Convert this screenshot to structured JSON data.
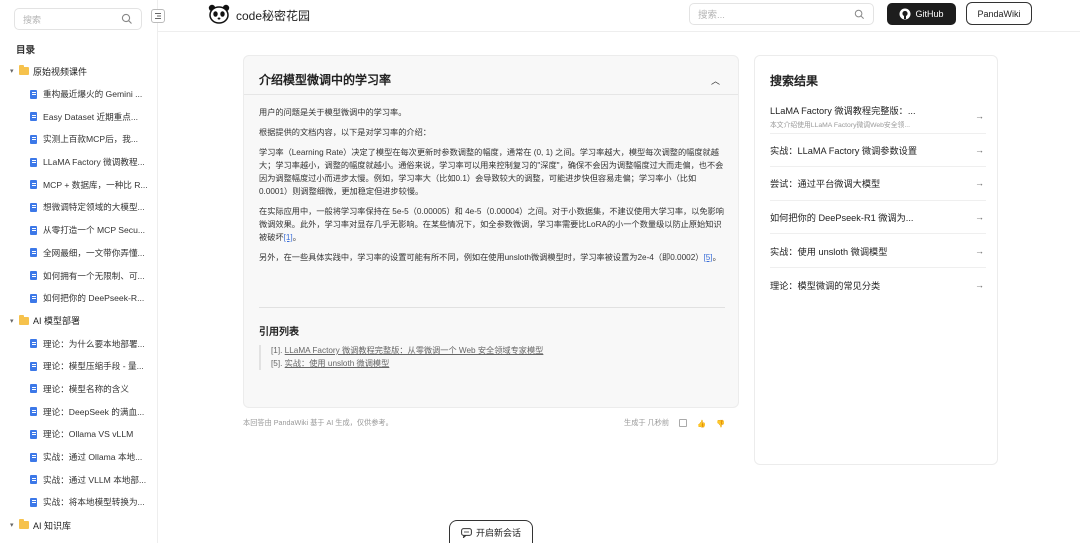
{
  "sidebar": {
    "search_placeholder": "搜索",
    "toc_title": "目录",
    "folders": [
      {
        "label": "原始视频课件",
        "docs": [
          "重构最近爆火的 Gemini ...",
          "Easy Dataset 近期重点...",
          "实测上百款MCP后，我...",
          "LLaMA Factory 微调教程...",
          "MCP + 数据库，一种比 R...",
          "想微调特定领域的大模型...",
          "从零打造一个 MCP Secu...",
          "全网最细，一文带你弄懂...",
          "如何拥有一个无限制、可...",
          "如何把你的 DeePseek-R..."
        ]
      },
      {
        "label": "AI 模型部署",
        "docs": [
          "理论：为什么要本地部署...",
          "理论：模型压缩手段 - 量...",
          "理论：模型名称的含义",
          "理论：DeepSeek 的满血...",
          "理论：Ollama VS vLLM",
          "实战：通过 Ollama 本地...",
          "实战：通过 VLLM 本地部...",
          "实战：将本地模型转换为..."
        ]
      },
      {
        "label": "AI 知识库",
        "docs": []
      }
    ]
  },
  "header": {
    "brand": "code秘密花园",
    "search_placeholder": "搜索...",
    "github_label": "GitHub",
    "pandawiki_label": "PandaWiki"
  },
  "answer": {
    "title": "介绍模型微调中的学习率",
    "p1": "用户的问题是关于模型微调中的学习率。",
    "p2": "根据提供的文档内容，以下是对学习率的介绍：",
    "p3": "学习率（Learning Rate）决定了模型在每次更新时参数调整的幅度，通常在 (0, 1) 之间。学习率越大，模型每次调整的幅度就越大；学习率越小，调整的幅度就越小。通俗来说，学习率可以用来控制复习的\"深度\"，确保不会因为调整幅度过大而走偏，也不会因为调整幅度过小而进步太慢。例如，学习率大（比如0.1）会导致较大的调整，可能进步快但容易走偏；学习率小（比如0.0001）则调整细微，更加稳定但进步较慢。",
    "p4": "在实际应用中，一般将学习率保持在 5e-5（0.00005）和 4e-5（0.00004）之间。对于小数据集，不建议使用大学习率，以免影响微调效果。此外，学习率对显存几乎无影响。在某些情况下，如全参数微调，学习率需要比LoRA的小一个数量级以防止原始知识被破坏",
    "p4_ref": "[1]",
    "p5": "另外，在一些具体实践中，学习率的设置可能有所不同，例如在使用unsloth微调模型时，学习率被设置为2e-4（即0.0002）",
    "p5_ref": "[5]",
    "refs_title": "引用列表",
    "ref1_num": "[1].",
    "ref1_text": "LLaMA Factory 微调教程完整版：从零微调一个 Web 安全领域专家模型",
    "ref2_num": "[5].",
    "ref2_text": "实战：使用 unsloth 微调模型",
    "footer_note": "本回答由 PandaWiki 基于 AI 生成，仅供参考。",
    "footer_time": "生成于 几秒前"
  },
  "results": {
    "title": "搜索结果",
    "items": [
      {
        "title": "LLaMA Factory 微调教程完整版：...",
        "sub": "本文介绍使用LLaMA Factory微调Web安全领..."
      },
      {
        "title": "实战：LLaMA Factory 微调参数设置",
        "sub": ""
      },
      {
        "title": "尝试：通过平台微调大模型",
        "sub": ""
      },
      {
        "title": "如何把你的 DeePseek-R1 微调为...",
        "sub": ""
      },
      {
        "title": "实战：使用 unsloth 微调模型",
        "sub": ""
      },
      {
        "title": "理论：模型微调的常见分类",
        "sub": ""
      }
    ]
  },
  "new_chat_label": "开启新会话"
}
